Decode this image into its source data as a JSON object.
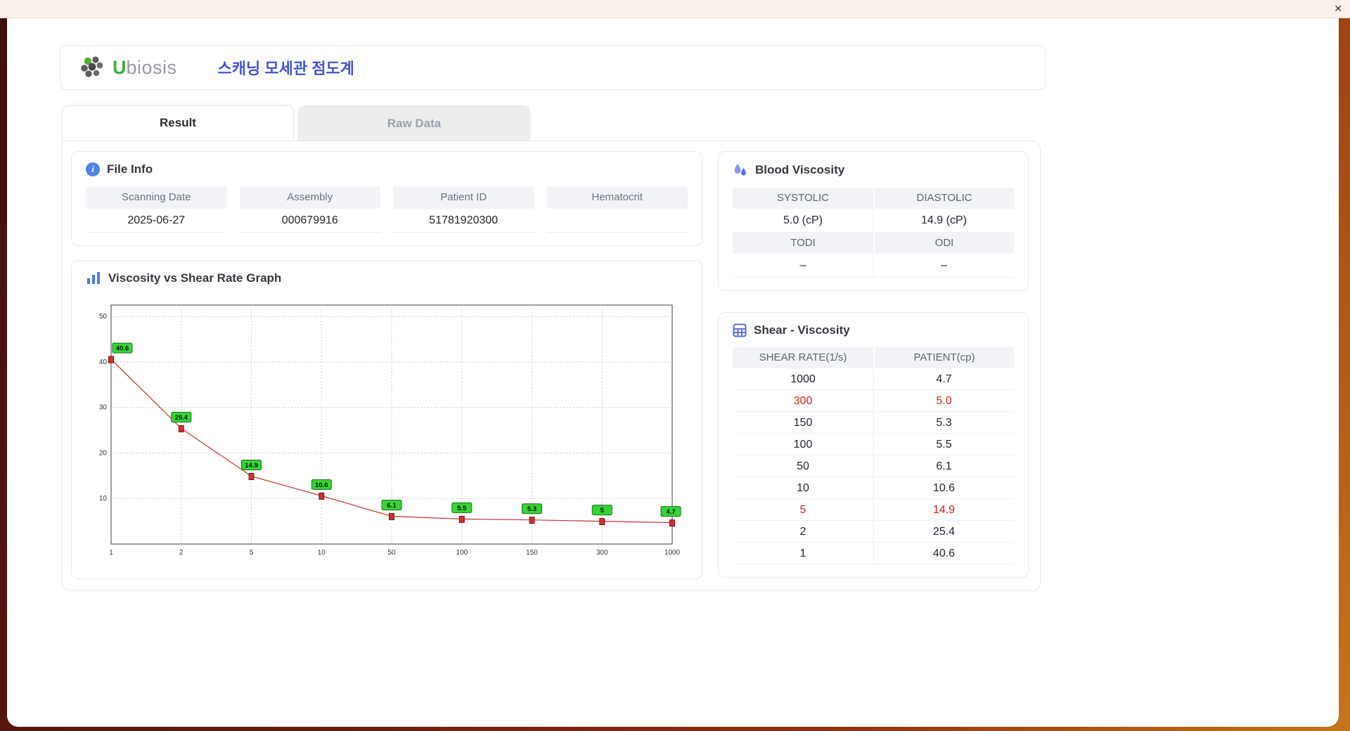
{
  "window": {
    "close_label": "✕"
  },
  "header": {
    "brand_u": "U",
    "brand_rest": "biosis",
    "title": "스캐닝 모세관 점도계"
  },
  "tabs": [
    {
      "label": "Result",
      "active": true
    },
    {
      "label": "Raw Data",
      "active": false
    }
  ],
  "file_info": {
    "title": "File Info",
    "icon": "info-icon",
    "icon_glyph": "i",
    "fields": [
      {
        "label": "Scanning Date",
        "value": "2025-06-27"
      },
      {
        "label": "Assembly",
        "value": "000679916"
      },
      {
        "label": "Patient ID",
        "value": "51781920300"
      },
      {
        "label": "Hematocrit",
        "value": ""
      }
    ]
  },
  "blood_viscosity": {
    "title": "Blood Viscosity",
    "icon": "droplets-icon",
    "cells": [
      {
        "label": "SYSTOLIC",
        "value": "5.0 (cP)"
      },
      {
        "label": "DIASTOLIC",
        "value": "14.9 (cP)"
      },
      {
        "label": "TODI",
        "value": "–"
      },
      {
        "label": "ODI",
        "value": "–"
      }
    ]
  },
  "shear_table": {
    "title": "Shear - Viscosity",
    "icon": "calculator-icon",
    "columns": [
      "SHEAR RATE(1/s)",
      "PATIENT(cp)"
    ],
    "rows": [
      {
        "shear": "1000",
        "patient": "4.7",
        "highlight": false
      },
      {
        "shear": "300",
        "patient": "5.0",
        "highlight": true
      },
      {
        "shear": "150",
        "patient": "5.3",
        "highlight": false
      },
      {
        "shear": "100",
        "patient": "5.5",
        "highlight": false
      },
      {
        "shear": "50",
        "patient": "6.1",
        "highlight": false
      },
      {
        "shear": "10",
        "patient": "10.6",
        "highlight": false
      },
      {
        "shear": "5",
        "patient": "14.9",
        "highlight": true
      },
      {
        "shear": "2",
        "patient": "25.4",
        "highlight": false
      },
      {
        "shear": "1",
        "patient": "40.6",
        "highlight": false
      }
    ]
  },
  "graph": {
    "title": "Viscosity vs Shear Rate Graph",
    "icon": "bar-chart-icon"
  },
  "chart_data": {
    "type": "line",
    "title": "Viscosity vs Shear Rate Graph",
    "x": [
      1,
      2,
      5,
      10,
      50,
      100,
      150,
      300,
      1000
    ],
    "x_tick_labels": [
      "1",
      "2",
      "5",
      "10",
      "50",
      "100",
      "150",
      "300",
      "1000"
    ],
    "values": [
      40.6,
      25.4,
      14.9,
      10.6,
      6.1,
      5.5,
      5.3,
      5,
      4.7
    ],
    "point_labels": [
      "40.6",
      "25.4",
      "14.9",
      "10.6",
      "6.1",
      "5.5",
      "5.3",
      "5",
      "4.7"
    ],
    "yticks": [
      10,
      20,
      30,
      40,
      50
    ],
    "ylim": [
      0,
      52.5
    ],
    "x_scale": "categorical",
    "grid": true,
    "line_color": "#c43434",
    "marker_color": "#d03030",
    "label_bg_color": "#35d435"
  },
  "colors": {
    "accent_blue": "#4353d8",
    "brand_green": "#3fae3f",
    "highlight_red": "#cc2222",
    "label_green": "#35d435"
  }
}
